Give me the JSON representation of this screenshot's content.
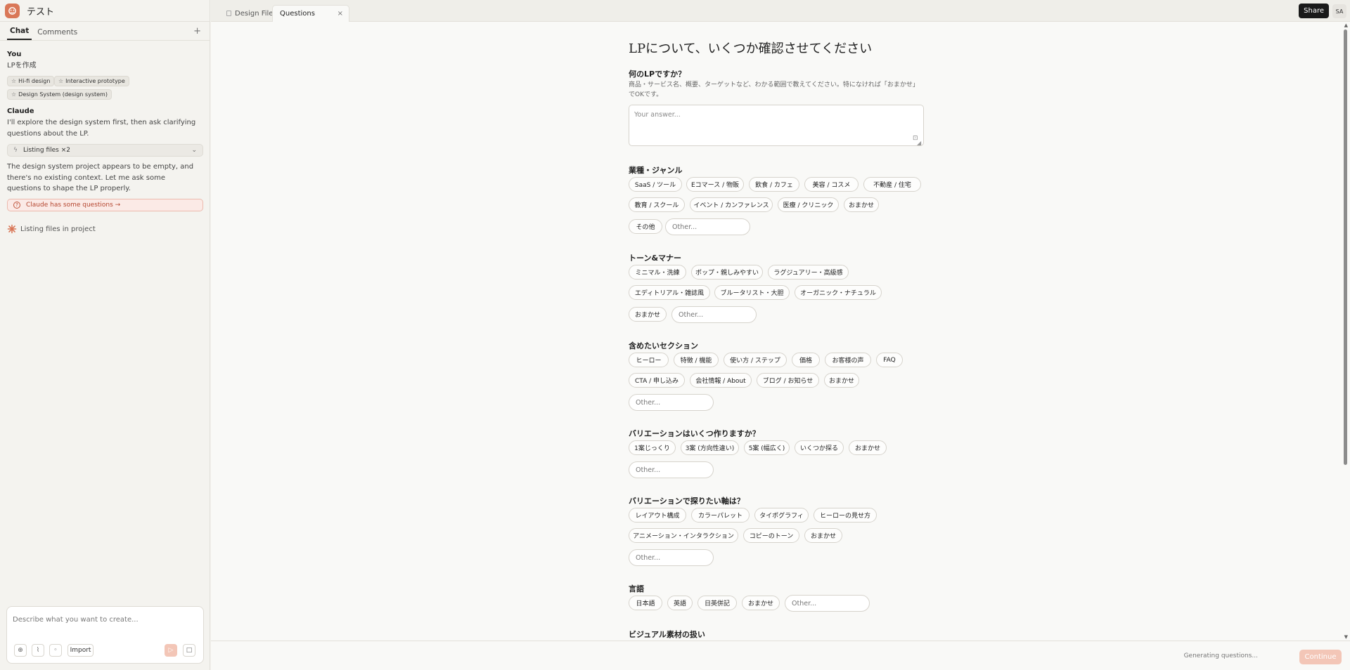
{
  "project": {
    "name": "テスト"
  },
  "sidebar": {
    "tabs": [
      {
        "label": "Chat"
      },
      {
        "label": "Comments"
      }
    ],
    "add_icon": "plus-icon",
    "user_message": {
      "author": "You",
      "text": "LPを作成",
      "chips": [
        "Hi-fi design",
        "Interactive prototype",
        "Design System (design system)"
      ]
    },
    "assistant_message": {
      "author": "Claude",
      "text1": "I'll explore the design system first, then ask clarifying questions about the LP.",
      "tool_call": "Listing files ×2",
      "text2": "The design system project appears to be empty, and there's no existing context. Let me ask some questions to shape the LP properly.",
      "questions_banner": "Claude has some questions →"
    },
    "status": "Listing files in project",
    "composer": {
      "placeholder": "Describe what you want to create...",
      "import_label": "Import"
    }
  },
  "topbar": {
    "tabs": [
      {
        "label": "Design Files"
      },
      {
        "label": "Questions"
      }
    ],
    "share_label": "Share",
    "avatar_initials": "SA"
  },
  "form": {
    "title": "LPについて、いくつか確認させてください",
    "q1": {
      "label": "何のLPですか？",
      "desc": "商品・サービス名、概要、ターゲットなど、わかる範囲で教えてください。特になければ「おまかせ」でOKです。",
      "placeholder": "Your answer..."
    },
    "q2": {
      "label": "業種・ジャンル",
      "options": [
        "SaaS / ツール",
        "Eコマース / 物販",
        "飲食 / カフェ",
        "美容 / コスメ",
        "不動産 / 住宅",
        "教育 / スクール",
        "イベント / カンファレンス",
        "医療 / クリニック",
        "おまかせ",
        "その他"
      ],
      "other": "Other..."
    },
    "q3": {
      "label": "トーン&マナー",
      "options": [
        "ミニマル・洗練",
        "ポップ・親しみやすい",
        "ラグジュアリー・高級感",
        "エディトリアル・雑誌風",
        "ブルータリスト・大胆",
        "オーガニック・ナチュラル",
        "おまかせ"
      ],
      "other": "Other..."
    },
    "q4": {
      "label": "含めたいセクション",
      "options": [
        "ヒーロー",
        "特徴 / 機能",
        "使い方 / ステップ",
        "価格",
        "お客様の声",
        "FAQ",
        "CTA / 申し込み",
        "会社情報 / About",
        "ブログ / お知らせ",
        "おまかせ"
      ],
      "other": "Other..."
    },
    "q5": {
      "label": "バリエーションはいくつ作りますか？",
      "options": [
        "1案じっくり",
        "3案 (方向性違い)",
        "5案 (幅広く)",
        "いくつか探る",
        "おまかせ"
      ],
      "other": "Other..."
    },
    "q6": {
      "label": "バリエーションで探りたい軸は？",
      "options": [
        "レイアウト構成",
        "カラーパレット",
        "タイポグラフィ",
        "ヒーローの見せ方",
        "アニメーション・インタラクション",
        "コピーのトーン",
        "おまかせ"
      ],
      "other": "Other..."
    },
    "q7": {
      "label": "言語",
      "options": [
        "日本語",
        "英語",
        "日英併記",
        "おまかせ"
      ],
      "other": "Other..."
    },
    "q8": {
      "label": "ビジュアル素材の扱い"
    }
  },
  "footer": {
    "status": "Generating questions...",
    "continue_label": "Continue"
  },
  "colors": {
    "accent": "#d97757",
    "accent_light": "#f3c6b7",
    "banner_text": "#b4452e"
  }
}
